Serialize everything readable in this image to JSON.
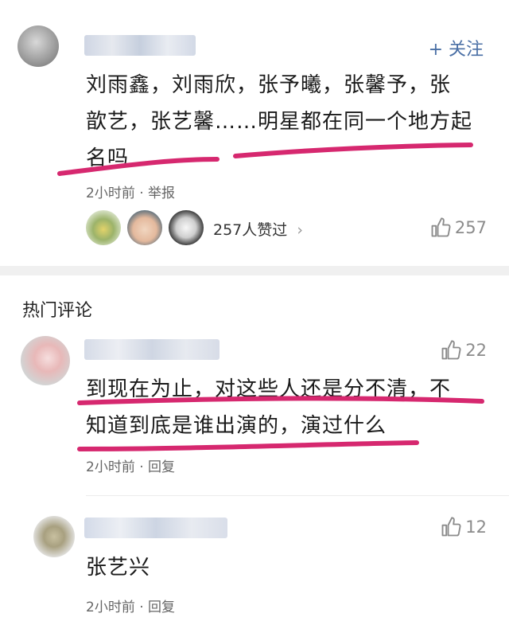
{
  "top_comment": {
    "follow_label": "+ 关注",
    "text_line1": "刘雨鑫，刘雨欣，张予曦，张馨予，张",
    "text_line2": "歆艺，张艺馨……明星都在同一个地方起",
    "text_line3": "名吗",
    "meta": "2小时前 · 举报",
    "likers_label": "257人赞过",
    "likers_chevron": "›",
    "like_count": "257"
  },
  "hot_section": {
    "title": "热门评论"
  },
  "comments": [
    {
      "like_count": "22",
      "text_line1": "到现在为止，对这些人还是分不清，不",
      "text_line2": "知道到底是谁出演的，演过什么",
      "meta": "2小时前 · 回复"
    },
    {
      "like_count": "12",
      "text_line1": "张艺兴",
      "meta": "2小时前 · 回复"
    }
  ],
  "colors": {
    "accent_blue": "#4a6fa5",
    "underline_pink": "#d6286f",
    "meta_grey": "#666666"
  }
}
